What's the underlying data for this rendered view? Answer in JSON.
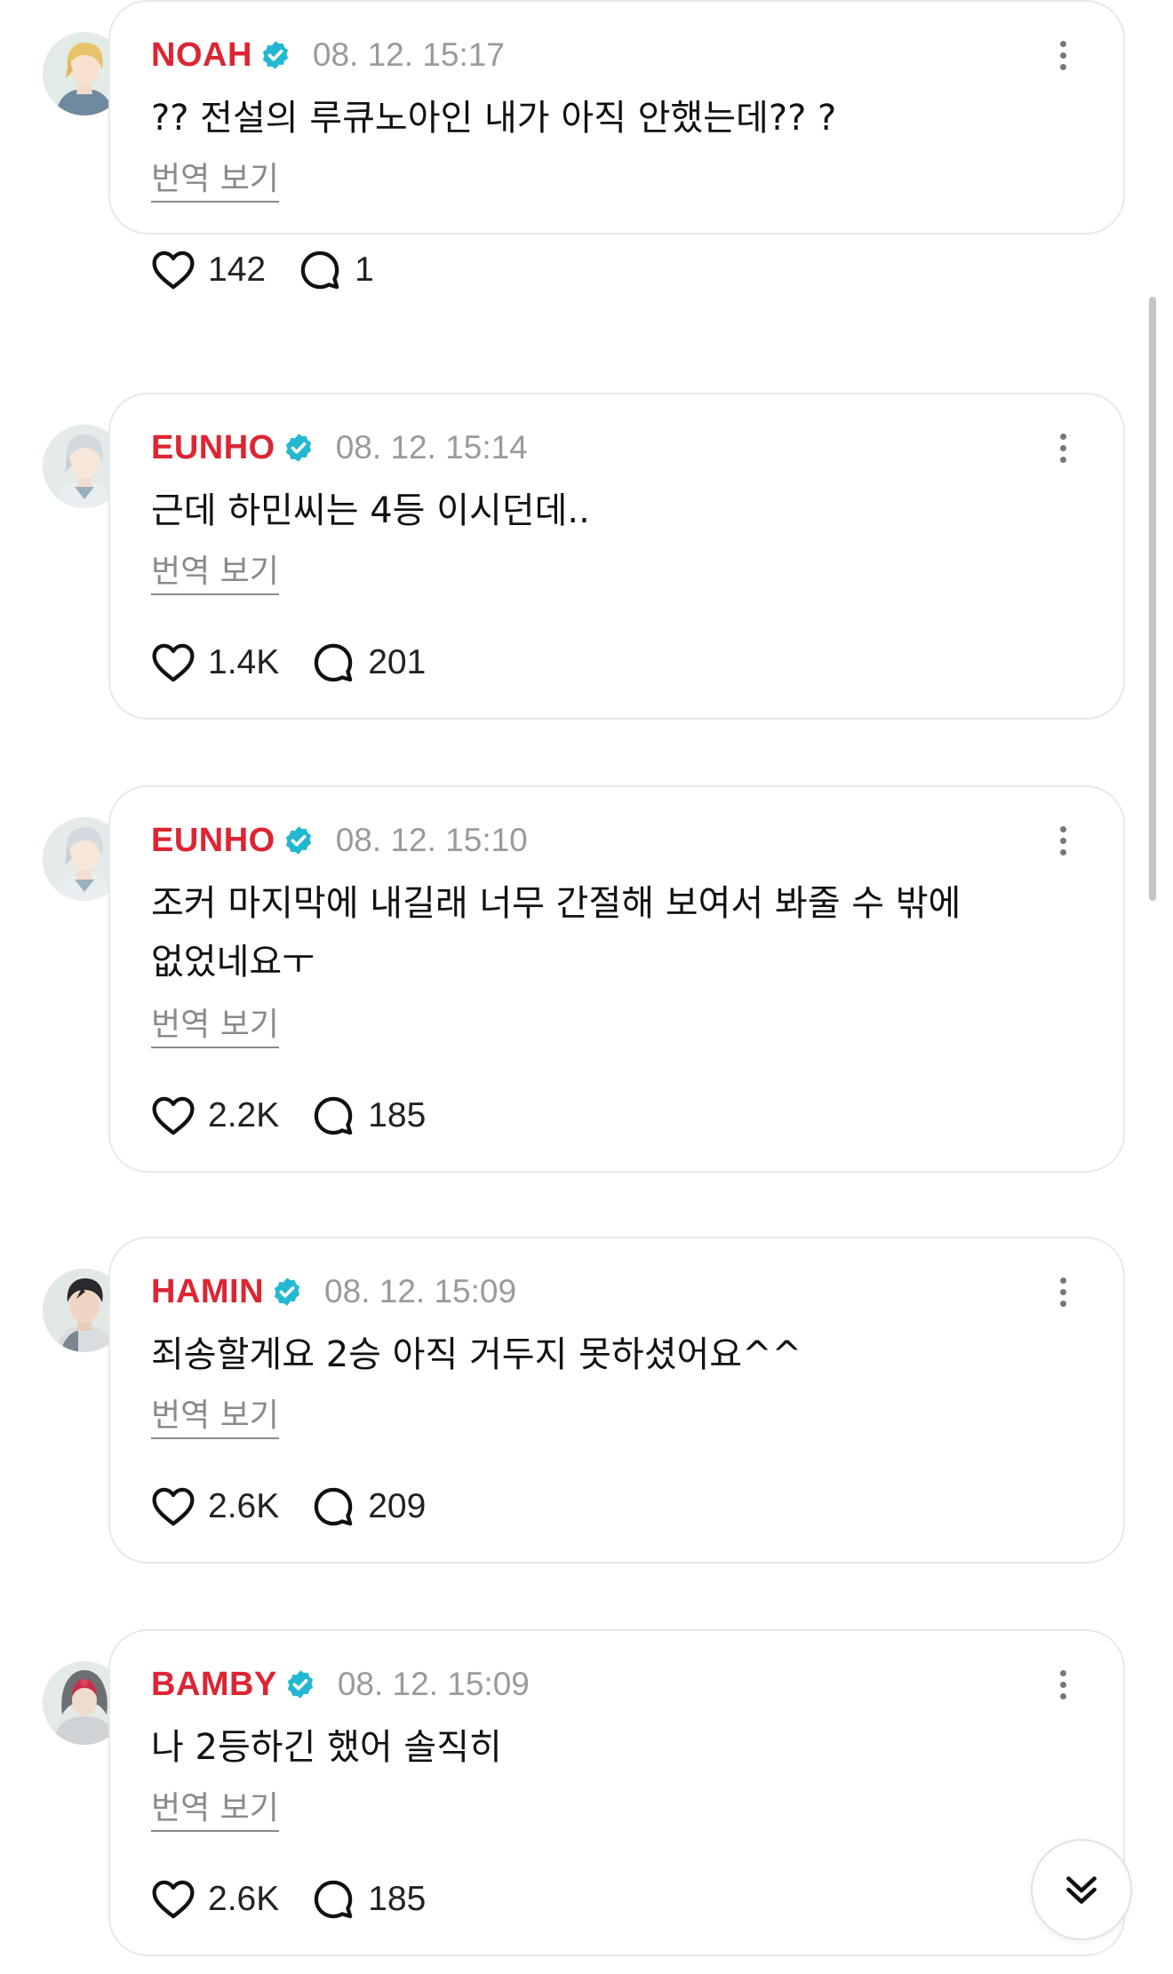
{
  "colors": {
    "username": "#dd2533",
    "verified_badge": "#22b8d1",
    "timestamp": "#9a9a9a",
    "translate_link": "#8a8a8a",
    "card_border": "#e8e8e8"
  },
  "comments": [
    {
      "username": "NOAH",
      "verified": true,
      "timestamp": "08. 12. 15:17",
      "text": "?? 전설의 루큐노아인 내가 아직 안했는데?? ?",
      "translate_label": "번역 보기",
      "likes": "142",
      "replies": "1",
      "avatar_icon": "blonde-character-avatar"
    },
    {
      "username": "EUNHO",
      "verified": true,
      "timestamp": "08. 12. 15:14",
      "text": "근데 하민씨는 4등 이시던데..",
      "translate_label": "번역 보기",
      "likes": "1.4K",
      "replies": "201",
      "avatar_icon": "silver-hair-character-avatar"
    },
    {
      "username": "EUNHO",
      "verified": true,
      "timestamp": "08. 12. 15:10",
      "text": "조커 마지막에 내길래 너무 간절해 보여서 봐줄 수 밖에\n없었네요ㅜ",
      "translate_label": "번역 보기",
      "likes": "2.2K",
      "replies": "185",
      "avatar_icon": "silver-hair-character-avatar"
    },
    {
      "username": "HAMIN",
      "verified": true,
      "timestamp": "08. 12. 15:09",
      "text": "죄송할게요 2승 아직 거두지 못하셨어요^^",
      "translate_label": "번역 보기",
      "likes": "2.6K",
      "replies": "209",
      "avatar_icon": "dark-hair-character-avatar"
    },
    {
      "username": "BAMBY",
      "verified": true,
      "timestamp": "08. 12. 15:09",
      "text": "나 2등하긴 했어 솔직히",
      "translate_label": "번역 보기",
      "likes": "2.6K",
      "replies": "185",
      "avatar_icon": "hooded-character-avatar"
    }
  ],
  "icons": {
    "like": "heart-icon",
    "reply": "comment-bubble-icon",
    "more": "more-vertical-icon",
    "verified": "verified-check-icon",
    "scroll": "double-chevron-down-icon"
  }
}
